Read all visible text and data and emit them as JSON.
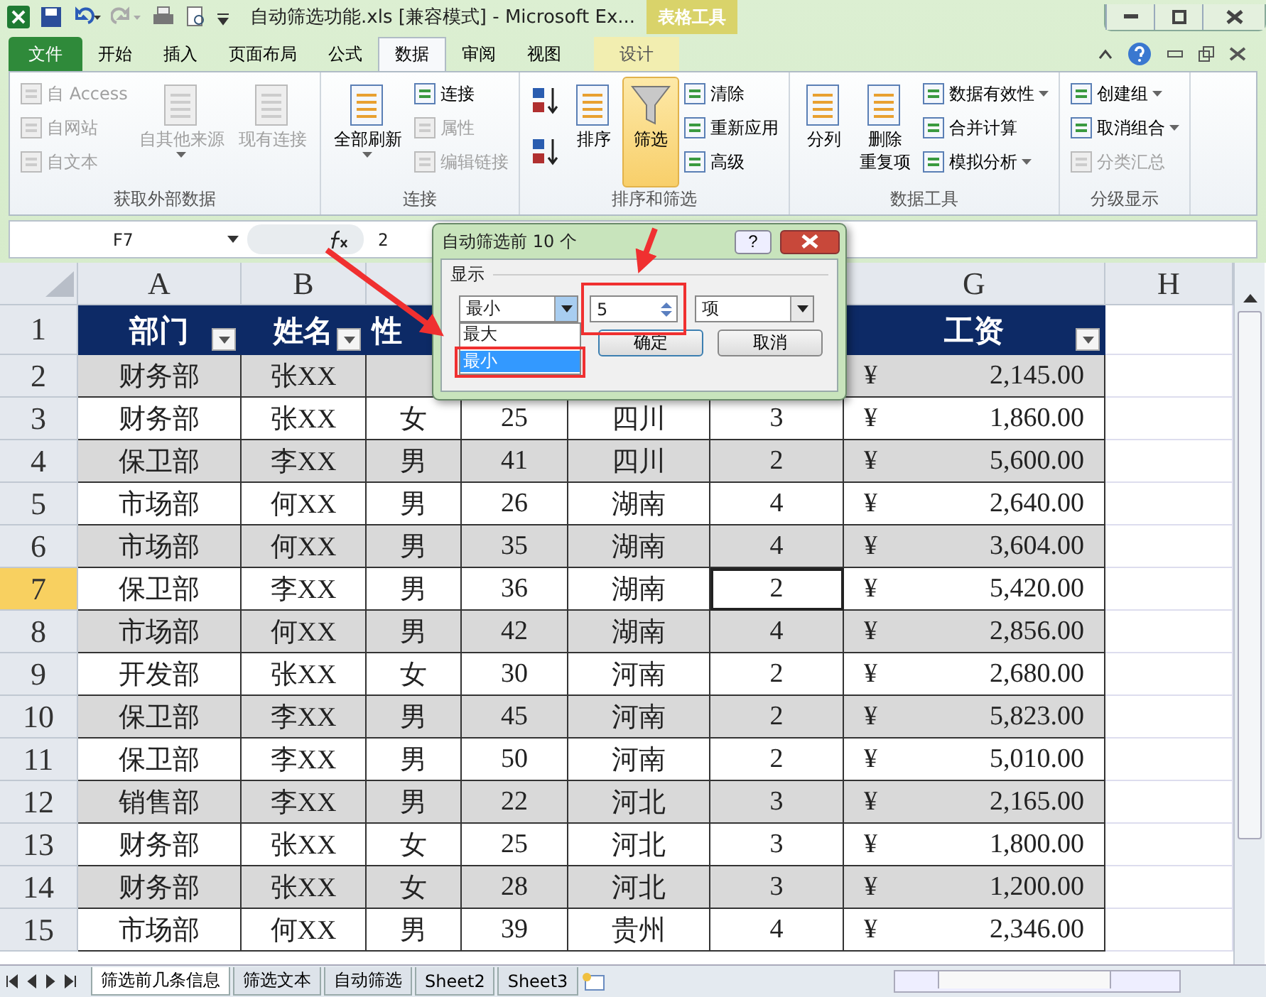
{
  "window": {
    "title": "自动筛选功能.xls  [兼容模式]  -  Microsoft Ex...",
    "context_tab": "表格工具"
  },
  "ribbon_tabs": [
    {
      "label": "文件",
      "kind": "file",
      "selected": false
    },
    {
      "label": "开始",
      "kind": "tab",
      "selected": false
    },
    {
      "label": "插入",
      "kind": "tab",
      "selected": false
    },
    {
      "label": "页面布局",
      "kind": "tab",
      "selected": false
    },
    {
      "label": "公式",
      "kind": "tab",
      "selected": false
    },
    {
      "label": "数据",
      "kind": "tab",
      "selected": true
    },
    {
      "label": "审阅",
      "kind": "tab",
      "selected": false
    },
    {
      "label": "视图",
      "kind": "tab",
      "selected": false
    },
    {
      "label": "设计",
      "kind": "context",
      "selected": false
    }
  ],
  "ribbon_groups": [
    {
      "title": "获取外部数据",
      "items": [
        {
          "kind": "small",
          "label": "自 Access",
          "disabled": true
        },
        {
          "kind": "small",
          "label": "自网站",
          "disabled": true
        },
        {
          "kind": "small",
          "label": "自文本",
          "disabled": true
        },
        {
          "kind": "large",
          "label": "自其他来源",
          "disabled": true,
          "dropdown": true
        },
        {
          "kind": "large",
          "label": "现有连接",
          "disabled": true
        }
      ]
    },
    {
      "title": "连接",
      "items": [
        {
          "kind": "large",
          "label": "全部刷新",
          "disabled": false,
          "dropdown": true
        },
        {
          "kind": "small",
          "label": "连接",
          "disabled": false
        },
        {
          "kind": "small",
          "label": "属性",
          "disabled": true
        },
        {
          "kind": "small",
          "label": "编辑链接",
          "disabled": true
        }
      ]
    },
    {
      "title": "排序和筛选",
      "items": [
        {
          "kind": "sort"
        },
        {
          "kind": "sort"
        },
        {
          "kind": "large",
          "label": "排序",
          "disabled": false
        },
        {
          "kind": "toggle",
          "label": "筛选",
          "disabled": false,
          "on": true
        },
        {
          "kind": "small",
          "label": "清除",
          "disabled": false
        },
        {
          "kind": "small",
          "label": "重新应用",
          "disabled": false
        },
        {
          "kind": "small",
          "label": "高级",
          "disabled": false
        }
      ]
    },
    {
      "title": "数据工具",
      "items": [
        {
          "kind": "large",
          "label": "分列",
          "disabled": false
        },
        {
          "kind": "large",
          "label": "删除",
          "label_2": "重复项",
          "disabled": false
        },
        {
          "kind": "small",
          "label": "数据有效性",
          "disabled": false,
          "dropdown": true
        },
        {
          "kind": "small",
          "label": "合并计算",
          "disabled": false
        },
        {
          "kind": "small",
          "label": "模拟分析",
          "disabled": false,
          "dropdown": true
        }
      ]
    },
    {
      "title": "分级显示",
      "items": [
        {
          "kind": "small",
          "label": "创建组",
          "disabled": false,
          "dropdown": true
        },
        {
          "kind": "small",
          "label": "取消组合",
          "disabled": false,
          "dropdown": true
        },
        {
          "kind": "small",
          "label": "分类汇总",
          "disabled": true
        }
      ]
    }
  ],
  "formula_bar": {
    "name_box": "F7",
    "value": "2"
  },
  "columns": [
    "A",
    "B",
    null,
    null,
    null,
    null,
    "G",
    "H"
  ],
  "header_row": {
    "num": "1",
    "cells": [
      {
        "label": "部门",
        "filter": true
      },
      {
        "label": "姓名",
        "filter": true
      },
      {
        "label": "性",
        "filter": false
      },
      null,
      null,
      null,
      {
        "label": "工资",
        "filter": true
      }
    ]
  },
  "rows": [
    {
      "num": "2",
      "selected": false,
      "cells": [
        "财务部",
        "张XX",
        null,
        null,
        null,
        null
      ],
      "currency": "¥",
      "amount": "2,145.00"
    },
    {
      "num": "3",
      "selected": false,
      "cells": [
        "财务部",
        "张XX",
        "女",
        "25",
        "四川",
        "3"
      ],
      "currency": "¥",
      "amount": "1,860.00"
    },
    {
      "num": "4",
      "selected": false,
      "cells": [
        "保卫部",
        "李XX",
        "男",
        "41",
        "四川",
        "2"
      ],
      "currency": "¥",
      "amount": "5,600.00"
    },
    {
      "num": "5",
      "selected": false,
      "cells": [
        "市场部",
        "何XX",
        "男",
        "26",
        "湖南",
        "4"
      ],
      "currency": "¥",
      "amount": "2,640.00"
    },
    {
      "num": "6",
      "selected": false,
      "cells": [
        "市场部",
        "何XX",
        "男",
        "35",
        "湖南",
        "4"
      ],
      "currency": "¥",
      "amount": "3,604.00"
    },
    {
      "num": "7",
      "selected": true,
      "cells": [
        "保卫部",
        "李XX",
        "男",
        "36",
        "湖南",
        {
          "text": "2",
          "active": true
        }
      ],
      "currency": "¥",
      "amount": "5,420.00"
    },
    {
      "num": "8",
      "selected": false,
      "cells": [
        "市场部",
        "何XX",
        "男",
        "42",
        "湖南",
        "4"
      ],
      "currency": "¥",
      "amount": "2,856.00"
    },
    {
      "num": "9",
      "selected": false,
      "cells": [
        "开发部",
        "张XX",
        "女",
        "30",
        "河南",
        "2"
      ],
      "currency": "¥",
      "amount": "2,680.00"
    },
    {
      "num": "10",
      "selected": false,
      "cells": [
        "保卫部",
        "李XX",
        "男",
        "45",
        "河南",
        "2"
      ],
      "currency": "¥",
      "amount": "5,823.00"
    },
    {
      "num": "11",
      "selected": false,
      "cells": [
        "保卫部",
        "李XX",
        "男",
        "50",
        "河南",
        "2"
      ],
      "currency": "¥",
      "amount": "5,010.00"
    },
    {
      "num": "12",
      "selected": false,
      "cells": [
        "销售部",
        "李XX",
        "男",
        "22",
        "河北",
        "3"
      ],
      "currency": "¥",
      "amount": "2,165.00"
    },
    {
      "num": "13",
      "selected": false,
      "cells": [
        "财务部",
        "张XX",
        "女",
        "25",
        "河北",
        "3"
      ],
      "currency": "¥",
      "amount": "1,800.00"
    },
    {
      "num": "14",
      "selected": false,
      "cells": [
        "财务部",
        "张XX",
        "女",
        "28",
        "河北",
        "3"
      ],
      "currency": "¥",
      "amount": "1,200.00"
    },
    {
      "num": "15",
      "selected": false,
      "cells": [
        "市场部",
        "何XX",
        "男",
        "39",
        "贵州",
        "4"
      ],
      "currency": "¥",
      "amount": "2,346.00"
    }
  ],
  "sheet_tabs": [
    {
      "label": "筛选前几条信息",
      "selected": true
    },
    {
      "label": "筛选文本",
      "selected": false
    },
    {
      "label": "自动筛选",
      "selected": false
    },
    {
      "label": "Sheet2",
      "selected": false
    },
    {
      "label": "Sheet3",
      "selected": false
    }
  ],
  "dialog": {
    "title": "自动筛选前 10 个",
    "help": "?",
    "group": "显示",
    "order_value": "最小",
    "count_value": "5",
    "unit_value": "项",
    "options": [
      {
        "label": "最大",
        "selected": false
      },
      {
        "label": "最小",
        "selected": true
      }
    ],
    "ok": "确定",
    "cancel": "取消"
  }
}
